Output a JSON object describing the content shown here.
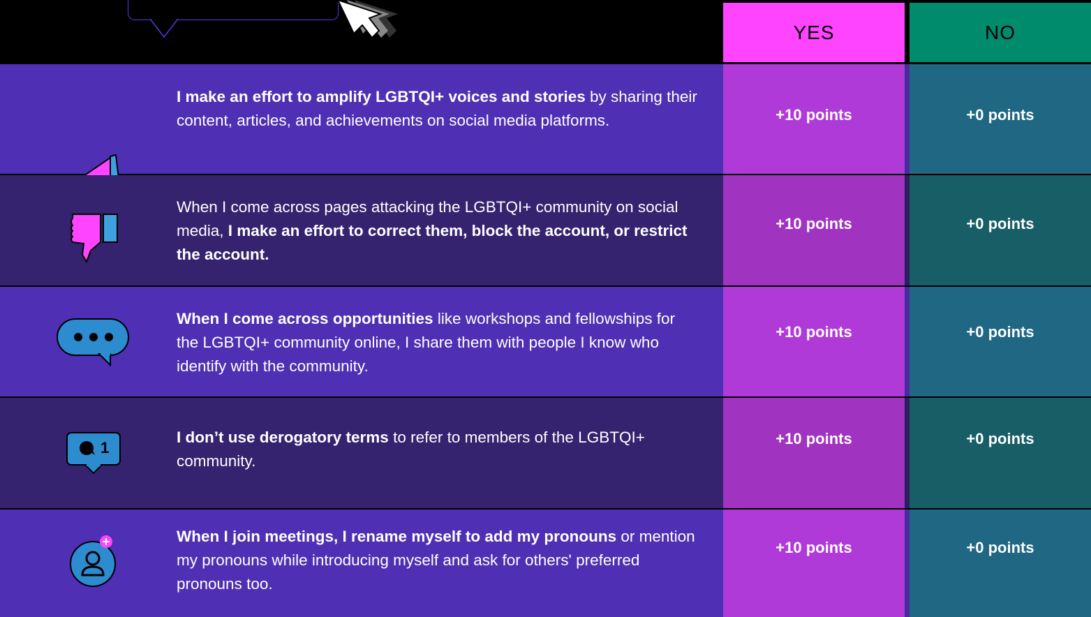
{
  "header": {
    "yes_label": "YES",
    "no_label": "NO",
    "colors": {
      "yes": "#ff44ff",
      "no": "#008c6c"
    }
  },
  "rows": [
    {
      "icon": "megaphone-icon",
      "text_bold": "I make an effort to amplify LGBTQI+ voices and stories",
      "text_plain": " by sharing their content, articles, and achievements on social media platforms.",
      "yes": "+10 points",
      "no": "+0 points"
    },
    {
      "icon": "thumbs-down-icon",
      "text_plain": "When I come across pages attacking the LGBTQI+ community on social media, ",
      "text_bold": "I make an effort to correct them, block the account, or restrict the account.",
      "yes": "+10 points",
      "no": "+0 points"
    },
    {
      "icon": "chat-bubble-icon",
      "text_bold": "When I come across opportunities",
      "text_plain": " like workshops and fellowships for the LGBTQI+ community online, I share them with people I know who identify with the community.",
      "yes": "+10 points",
      "no": "+0 points"
    },
    {
      "icon": "comment-notification-icon",
      "notification_count": "1",
      "text_bold": "I don’t use derogatory terms",
      "text_plain": " to refer to members of the LGBTQI+ community.",
      "yes": "+10 points",
      "no": "+0 points"
    },
    {
      "icon": "add-user-icon",
      "text_bold": "When I join meetings, I rename myself to add my pronouns",
      "text_plain": " or mention my pronouns while introducing myself and ask for others' preferred pronouns too.",
      "yes": "+10 points",
      "no": "+0 points"
    }
  ]
}
